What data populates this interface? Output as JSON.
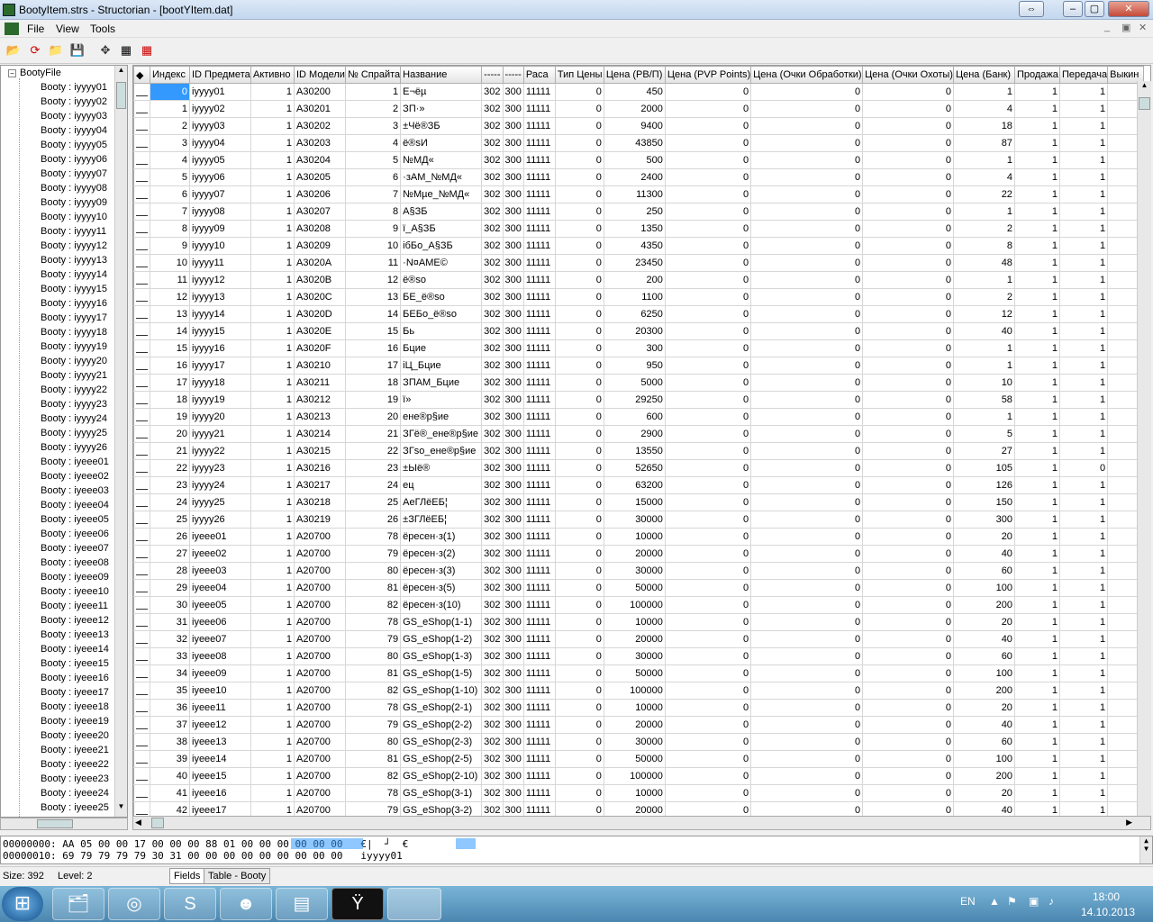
{
  "window": {
    "title": "BootyItem.strs - Structorian - [bootYItem.dat]"
  },
  "menu": [
    "File",
    "View",
    "Tools"
  ],
  "tree": {
    "root": "BootyFile",
    "items": [
      "Booty : iyyyy01",
      "Booty : iyyyy02",
      "Booty : iyyyy03",
      "Booty : iyyyy04",
      "Booty : iyyyy05",
      "Booty : iyyyy06",
      "Booty : iyyyy07",
      "Booty : iyyyy08",
      "Booty : iyyyy09",
      "Booty : iyyyy10",
      "Booty : iyyyy11",
      "Booty : iyyyy12",
      "Booty : iyyyy13",
      "Booty : iyyyy14",
      "Booty : iyyyy15",
      "Booty : iyyyy16",
      "Booty : iyyyy17",
      "Booty : iyyyy18",
      "Booty : iyyyy19",
      "Booty : iyyyy20",
      "Booty : iyyyy21",
      "Booty : iyyyy22",
      "Booty : iyyyy23",
      "Booty : iyyyy24",
      "Booty : iyyyy25",
      "Booty : iyyyy26",
      "Booty : iyeee01",
      "Booty : iyeee02",
      "Booty : iyeee03",
      "Booty : iyeee04",
      "Booty : iyeee05",
      "Booty : iyeee06",
      "Booty : iyeee07",
      "Booty : iyeee08",
      "Booty : iyeee09",
      "Booty : iyeee10",
      "Booty : iyeee11",
      "Booty : iyeee12",
      "Booty : iyeee13",
      "Booty : iyeee14",
      "Booty : iyeee15",
      "Booty : iyeee16",
      "Booty : iyeee17",
      "Booty : iyeee18",
      "Booty : iyeee19",
      "Booty : iyeee20",
      "Booty : iyeee21",
      "Booty : iyeee22",
      "Booty : iyeee23",
      "Booty : iyeee24",
      "Booty : iyeee25"
    ]
  },
  "grid": {
    "columns": [
      "Индекс",
      "ID Предмета",
      "Активно",
      "ID Модели",
      "№ Спрайта",
      "Название",
      "-----",
      "-----",
      "Раса",
      "Тип Цены",
      "Цена (РВ/П)",
      "Цена (PVP Points)",
      "Цена (Очки Обработки)",
      "Цена (Очки Охоты)",
      "Цена (Банк)",
      "Продажа",
      "Передача",
      "Выкин"
    ],
    "rows": [
      [
        "0",
        "iyyyy01",
        "1",
        "A30200",
        "1",
        "Е¬ёµ",
        "302",
        "300",
        "11111",
        "0",
        "450",
        "0",
        "0",
        "0",
        "1",
        "1",
        "1"
      ],
      [
        "1",
        "iyyyy02",
        "1",
        "A30201",
        "2",
        "ЗП·»",
        "302",
        "300",
        "11111",
        "0",
        "2000",
        "0",
        "0",
        "0",
        "4",
        "1",
        "1"
      ],
      [
        "2",
        "iyyyy03",
        "1",
        "A30202",
        "3",
        "±Чё®ЗБ",
        "302",
        "300",
        "11111",
        "0",
        "9400",
        "0",
        "0",
        "0",
        "18",
        "1",
        "1"
      ],
      [
        "3",
        "iyyyy04",
        "1",
        "A30203",
        "4",
        "ё®sИ",
        "302",
        "300",
        "11111",
        "0",
        "43850",
        "0",
        "0",
        "0",
        "87",
        "1",
        "1"
      ],
      [
        "4",
        "iyyyy05",
        "1",
        "A30204",
        "5",
        "№МД«",
        "302",
        "300",
        "11111",
        "0",
        "500",
        "0",
        "0",
        "0",
        "1",
        "1",
        "1"
      ],
      [
        "5",
        "iyyyy06",
        "1",
        "A30205",
        "6",
        "·зАМ_№МД«",
        "302",
        "300",
        "11111",
        "0",
        "2400",
        "0",
        "0",
        "0",
        "4",
        "1",
        "1"
      ],
      [
        "6",
        "iyyyy07",
        "1",
        "A30206",
        "7",
        "№Мµе_№МД«",
        "302",
        "300",
        "11111",
        "0",
        "11300",
        "0",
        "0",
        "0",
        "22",
        "1",
        "1"
      ],
      [
        "7",
        "iyyyy08",
        "1",
        "A30207",
        "8",
        "А§ЗБ",
        "302",
        "300",
        "11111",
        "0",
        "250",
        "0",
        "0",
        "0",
        "1",
        "1",
        "1"
      ],
      [
        "8",
        "iyyyy09",
        "1",
        "A30208",
        "9",
        "ї_А§ЗБ",
        "302",
        "300",
        "11111",
        "0",
        "1350",
        "0",
        "0",
        "0",
        "2",
        "1",
        "1"
      ],
      [
        "9",
        "iyyyy10",
        "1",
        "A30209",
        "10",
        "ібБо_А§ЗБ",
        "302",
        "300",
        "11111",
        "0",
        "4350",
        "0",
        "0",
        "0",
        "8",
        "1",
        "1"
      ],
      [
        "10",
        "iyyyy11",
        "1",
        "A3020A",
        "11",
        "·N¤AME©",
        "302",
        "300",
        "11111",
        "0",
        "23450",
        "0",
        "0",
        "0",
        "48",
        "1",
        "1"
      ],
      [
        "11",
        "iyyyy12",
        "1",
        "A3020B",
        "12",
        "ё®ѕо",
        "302",
        "300",
        "11111",
        "0",
        "200",
        "0",
        "0",
        "0",
        "1",
        "1",
        "1"
      ],
      [
        "12",
        "iyyyy13",
        "1",
        "A3020C",
        "13",
        "БЕ_ё®ѕо",
        "302",
        "300",
        "11111",
        "0",
        "1100",
        "0",
        "0",
        "0",
        "2",
        "1",
        "1"
      ],
      [
        "13",
        "iyyyy14",
        "1",
        "A3020D",
        "14",
        "БЕБо_ё®ѕо",
        "302",
        "300",
        "11111",
        "0",
        "6250",
        "0",
        "0",
        "0",
        "12",
        "1",
        "1"
      ],
      [
        "14",
        "iyyyy15",
        "1",
        "A3020E",
        "15",
        "Бь",
        "302",
        "300",
        "11111",
        "0",
        "20300",
        "0",
        "0",
        "0",
        "40",
        "1",
        "1"
      ],
      [
        "15",
        "iyyyy16",
        "1",
        "A3020F",
        "16",
        "Бцие",
        "302",
        "300",
        "11111",
        "0",
        "300",
        "0",
        "0",
        "0",
        "1",
        "1",
        "1"
      ],
      [
        "16",
        "iyyyy17",
        "1",
        "A30210",
        "17",
        "іЦ_Бцие",
        "302",
        "300",
        "11111",
        "0",
        "950",
        "0",
        "0",
        "0",
        "1",
        "1",
        "1"
      ],
      [
        "17",
        "iyyyy18",
        "1",
        "A30211",
        "18",
        "ЗПАМ_Бцие",
        "302",
        "300",
        "11111",
        "0",
        "5000",
        "0",
        "0",
        "0",
        "10",
        "1",
        "1"
      ],
      [
        "18",
        "iyyyy19",
        "1",
        "A30212",
        "19",
        "ї»",
        "302",
        "300",
        "11111",
        "0",
        "29250",
        "0",
        "0",
        "0",
        "58",
        "1",
        "1"
      ],
      [
        "19",
        "iyyyy20",
        "1",
        "A30213",
        "20",
        "ене®р§ие",
        "302",
        "300",
        "11111",
        "0",
        "600",
        "0",
        "0",
        "0",
        "1",
        "1",
        "1"
      ],
      [
        "20",
        "iyyyy21",
        "1",
        "A30214",
        "21",
        "ЗГё®_ене®р§ие",
        "302",
        "300",
        "11111",
        "0",
        "2900",
        "0",
        "0",
        "0",
        "5",
        "1",
        "1"
      ],
      [
        "21",
        "iyyyy22",
        "1",
        "A30215",
        "22",
        "ЗГѕо_ене®р§ие",
        "302",
        "300",
        "11111",
        "0",
        "13550",
        "0",
        "0",
        "0",
        "27",
        "1",
        "1"
      ],
      [
        "22",
        "iyyyy23",
        "1",
        "A30216",
        "23",
        "±Ыё®",
        "302",
        "300",
        "11111",
        "0",
        "52650",
        "0",
        "0",
        "0",
        "105",
        "1",
        "0"
      ],
      [
        "23",
        "iyyyy24",
        "1",
        "A30217",
        "24",
        "ец",
        "302",
        "300",
        "11111",
        "0",
        "63200",
        "0",
        "0",
        "0",
        "126",
        "1",
        "1"
      ],
      [
        "24",
        "iyyyy25",
        "1",
        "A30218",
        "25",
        "АеГЛёЕБ¦",
        "302",
        "300",
        "11111",
        "0",
        "15000",
        "0",
        "0",
        "0",
        "150",
        "1",
        "1"
      ],
      [
        "25",
        "iyyyy26",
        "1",
        "A30219",
        "26",
        "±ЗГЛёЕБ¦",
        "302",
        "300",
        "11111",
        "0",
        "30000",
        "0",
        "0",
        "0",
        "300",
        "1",
        "1"
      ],
      [
        "26",
        "iyeee01",
        "1",
        "A20700",
        "78",
        "ёресен·з(1)",
        "302",
        "300",
        "11111",
        "0",
        "10000",
        "0",
        "0",
        "0",
        "20",
        "1",
        "1"
      ],
      [
        "27",
        "iyeee02",
        "1",
        "A20700",
        "79",
        "ёресен·з(2)",
        "302",
        "300",
        "11111",
        "0",
        "20000",
        "0",
        "0",
        "0",
        "40",
        "1",
        "1"
      ],
      [
        "28",
        "iyeee03",
        "1",
        "A20700",
        "80",
        "ёресен·з(3)",
        "302",
        "300",
        "11111",
        "0",
        "30000",
        "0",
        "0",
        "0",
        "60",
        "1",
        "1"
      ],
      [
        "29",
        "iyeee04",
        "1",
        "A20700",
        "81",
        "ёресен·з(5)",
        "302",
        "300",
        "11111",
        "0",
        "50000",
        "0",
        "0",
        "0",
        "100",
        "1",
        "1"
      ],
      [
        "30",
        "iyeee05",
        "1",
        "A20700",
        "82",
        "ёресен·з(10)",
        "302",
        "300",
        "11111",
        "0",
        "100000",
        "0",
        "0",
        "0",
        "200",
        "1",
        "1"
      ],
      [
        "31",
        "iyeee06",
        "1",
        "A20700",
        "78",
        "GS_eShop(1-1)",
        "302",
        "300",
        "11111",
        "0",
        "10000",
        "0",
        "0",
        "0",
        "20",
        "1",
        "1"
      ],
      [
        "32",
        "iyeee07",
        "1",
        "A20700",
        "79",
        "GS_eShop(1-2)",
        "302",
        "300",
        "11111",
        "0",
        "20000",
        "0",
        "0",
        "0",
        "40",
        "1",
        "1"
      ],
      [
        "33",
        "iyeee08",
        "1",
        "A20700",
        "80",
        "GS_eShop(1-3)",
        "302",
        "300",
        "11111",
        "0",
        "30000",
        "0",
        "0",
        "0",
        "60",
        "1",
        "1"
      ],
      [
        "34",
        "iyeee09",
        "1",
        "A20700",
        "81",
        "GS_eShop(1-5)",
        "302",
        "300",
        "11111",
        "0",
        "50000",
        "0",
        "0",
        "0",
        "100",
        "1",
        "1"
      ],
      [
        "35",
        "iyeee10",
        "1",
        "A20700",
        "82",
        "GS_eShop(1-10)",
        "302",
        "300",
        "11111",
        "0",
        "100000",
        "0",
        "0",
        "0",
        "200",
        "1",
        "1"
      ],
      [
        "36",
        "iyeee11",
        "1",
        "A20700",
        "78",
        "GS_eShop(2-1)",
        "302",
        "300",
        "11111",
        "0",
        "10000",
        "0",
        "0",
        "0",
        "20",
        "1",
        "1"
      ],
      [
        "37",
        "iyeee12",
        "1",
        "A20700",
        "79",
        "GS_eShop(2-2)",
        "302",
        "300",
        "11111",
        "0",
        "20000",
        "0",
        "0",
        "0",
        "40",
        "1",
        "1"
      ],
      [
        "38",
        "iyeee13",
        "1",
        "A20700",
        "80",
        "GS_eShop(2-3)",
        "302",
        "300",
        "11111",
        "0",
        "30000",
        "0",
        "0",
        "0",
        "60",
        "1",
        "1"
      ],
      [
        "39",
        "iyeee14",
        "1",
        "A20700",
        "81",
        "GS_eShop(2-5)",
        "302",
        "300",
        "11111",
        "0",
        "50000",
        "0",
        "0",
        "0",
        "100",
        "1",
        "1"
      ],
      [
        "40",
        "iyeee15",
        "1",
        "A20700",
        "82",
        "GS_eShop(2-10)",
        "302",
        "300",
        "11111",
        "0",
        "100000",
        "0",
        "0",
        "0",
        "200",
        "1",
        "1"
      ],
      [
        "41",
        "iyeee16",
        "1",
        "A20700",
        "78",
        "GS_eShop(3-1)",
        "302",
        "300",
        "11111",
        "0",
        "10000",
        "0",
        "0",
        "0",
        "20",
        "1",
        "1"
      ],
      [
        "42",
        "iyeee17",
        "1",
        "A20700",
        "79",
        "GS_eShop(3-2)",
        "302",
        "300",
        "11111",
        "0",
        "20000",
        "0",
        "0",
        "0",
        "40",
        "1",
        "1"
      ]
    ]
  },
  "hex": {
    "line1": "00000000: AA 05 00 00 17 00 00 00 88 01 00 00 00 00 00 00   €|  ┘  €",
    "line2": "00000010: 69 79 79 79 79 30 31 00 00 00 00 00 00 00 00 00   iyyyy01"
  },
  "status": {
    "size": "Size: 392",
    "level": "Level: 2",
    "tab_fields": "Fields",
    "tab_table": "Table - Booty"
  },
  "taskbar": {
    "lang": "EN",
    "time": "18:00",
    "date": "14.10.2013"
  }
}
